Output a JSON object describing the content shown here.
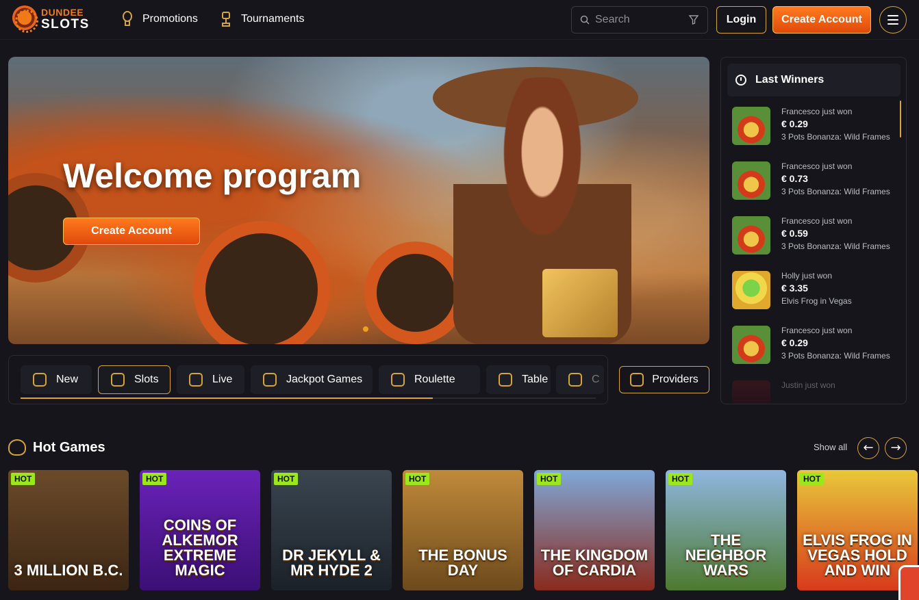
{
  "brand": {
    "name_top": "DUNDEE",
    "name_bottom": "SLOTS",
    "accent": "#d6a43a",
    "cta": "#e8631c"
  },
  "nav": [
    {
      "label": "Promotions",
      "icon": "lightbulb-icon"
    },
    {
      "label": "Tournaments",
      "icon": "trophy-icon"
    }
  ],
  "header": {
    "search_placeholder": "Search",
    "login_label": "Login",
    "create_account_label": "Create Account"
  },
  "hero": {
    "title": "Welcome program",
    "cta_label": "Create Account"
  },
  "winners": {
    "title": "Last Winners",
    "items": [
      {
        "who": "Francesco just won",
        "amount": "€ 0.29",
        "game": "3 Pots Bonanza: Wild Frames",
        "thumb": "pots"
      },
      {
        "who": "Francesco just won",
        "amount": "€ 0.73",
        "game": "3 Pots Bonanza: Wild Frames",
        "thumb": "pots"
      },
      {
        "who": "Francesco just won",
        "amount": "€ 0.59",
        "game": "3 Pots Bonanza: Wild Frames",
        "thumb": "pots"
      },
      {
        "who": "Holly just won",
        "amount": "€ 3.35",
        "game": "Elvis Frog in Vegas",
        "thumb": "frog"
      },
      {
        "who": "Francesco just won",
        "amount": "€ 0.29",
        "game": "3 Pots Bonanza: Wild Frames",
        "thumb": "pots"
      },
      {
        "who": "Justin just won",
        "amount": "",
        "game": "",
        "thumb": "red"
      }
    ]
  },
  "categories": [
    {
      "label": "New",
      "active": false
    },
    {
      "label": "Slots",
      "active": true
    },
    {
      "label": "Live",
      "active": false
    },
    {
      "label": "Jackpot Games",
      "active": false
    },
    {
      "label": "Roulette",
      "active": false
    },
    {
      "label": "Table",
      "active": false
    },
    {
      "label": "C",
      "active": false
    }
  ],
  "providers_label": "Providers",
  "hot_games": {
    "title": "Hot Games",
    "show_all": "Show all",
    "badge": "HOT",
    "games": [
      {
        "title": "3 MILLION B.C.",
        "color_top": "#6b4a2a",
        "color_bottom": "#3b2614"
      },
      {
        "title": "COINS OF ALKEMOR EXTREME MAGIC",
        "color_top": "#6a22b8",
        "color_bottom": "#3b0f75"
      },
      {
        "title": "DR JEKYLL & MR HYDE 2",
        "color_top": "#3a4550",
        "color_bottom": "#1b2128"
      },
      {
        "title": "THE BONUS DAY",
        "color_top": "#c08a3a",
        "color_bottom": "#6d4a1c"
      },
      {
        "title": "THE KINGDOM OF CARDIA",
        "color_top": "#7fa8d8",
        "color_bottom": "#8a2a1c"
      },
      {
        "title": "THE NEIGHBOR WARS",
        "color_top": "#8fb6e0",
        "color_bottom": "#4d7a2e"
      },
      {
        "title": "ELVIS FROG IN VEGAS HOLD AND WIN",
        "color_top": "#e8c83a",
        "color_bottom": "#d83a1c"
      }
    ]
  }
}
